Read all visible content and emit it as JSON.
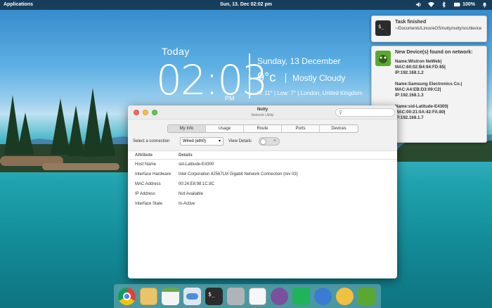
{
  "topbar": {
    "applications_label": "Applications",
    "clock": "Sun, 13. Dec  02:02 pm",
    "battery": "100%",
    "icons": [
      "volume-icon",
      "wifi-icon",
      "bluetooth-icon",
      "battery-icon",
      "notifications-icon"
    ]
  },
  "conky": {
    "today": "Today",
    "time": "02:03",
    "ampm": "PM",
    "date": "Sunday, 13 December",
    "temp": "9°c",
    "condition": "Mostly Cloudy",
    "details": "H: 11°  |  Low: 7°  |  London, United Kingdom"
  },
  "notifications": {
    "task": {
      "title": "Task finished",
      "body": "~/Documents/Linux/eOS/nutty/nutty/src/device"
    },
    "devices": {
      "title": "New Device(s) found on network:",
      "items": [
        {
          "name": "Name:Wistron NeWeb|",
          "mac": "MAC:60:02:B4:94:FD:85|",
          "ip": "IP:192.168.1.2"
        },
        {
          "name": "Name:Samsung Electronics Co.|",
          "mac": "MAC:A4:EB:D3:09:C2|",
          "ip": "IP:192.168.1.3"
        },
        {
          "name": "Name:sid-Latitude-E4300|",
          "mac": "MAC:00:21:0A:42:FA:80|",
          "ip": "IP:192.168.1.7"
        }
      ]
    }
  },
  "window": {
    "title": "Nutty",
    "subtitle": "Network Utility",
    "tabs": [
      "My Info",
      "Usage",
      "Route",
      "Ports",
      "Devices"
    ],
    "active_tab": "My Info",
    "connection_label": "Select a connection",
    "connection_value": "Wired (eth0)",
    "view_details_label": "View Details",
    "table": {
      "headers": [
        "Attribute",
        "Details"
      ],
      "rows": [
        [
          "Host Name",
          "sid-Latitude-E4300"
        ],
        [
          "Interface Hardware",
          "Intel Corporation 82567LM Gigabit Network Connection (rev 03)"
        ],
        [
          "MAC Address",
          "00:24:E8:98:1C:8C"
        ],
        [
          "IP Address",
          "Not Available"
        ],
        [
          "Interface State",
          "In-Active"
        ]
      ]
    }
  },
  "dock": {
    "icons": [
      "chrome-icon",
      "mail-icon",
      "spreadsheet-icon",
      "settings-toggle-icon",
      "terminal-icon",
      "files-icon",
      "text-editor-icon",
      "viber-icon",
      "slingshot-icon",
      "bird-icon",
      "coffee-icon",
      "nutty-icon"
    ]
  },
  "colors": {
    "topbar_bg": "#000000",
    "window_bg": "#ffffff",
    "nutty_green": "#5aa832"
  }
}
